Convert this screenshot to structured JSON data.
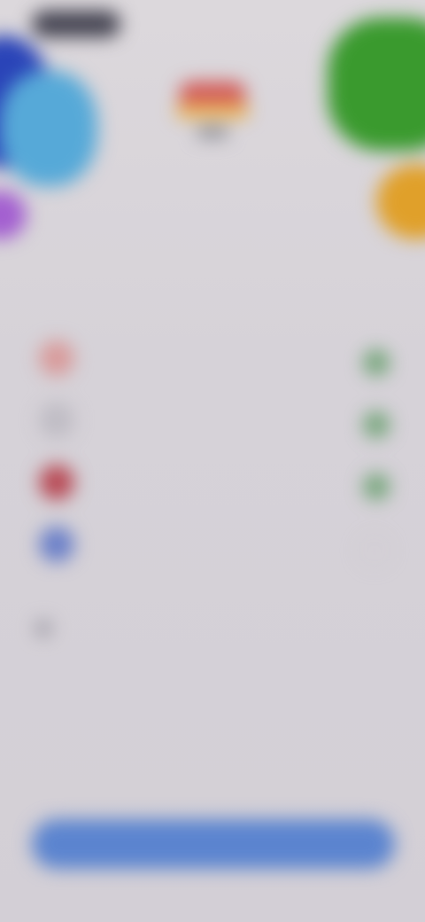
{
  "status_bar": {
    "time": ""
  },
  "header": {
    "title_main": "",
    "title_accent": "",
    "subtitle": ""
  },
  "section_caption": "",
  "permissions": [
    {
      "icon": "notification-icon",
      "title": "",
      "description": "",
      "granted": true,
      "color": "#d89a9a"
    },
    {
      "icon": "location-icon",
      "title": "",
      "description": "",
      "granted": true,
      "color": "#bfbcc4"
    },
    {
      "icon": "health-icon",
      "title": "",
      "description": "",
      "granted": true,
      "color": "#b84a55"
    },
    {
      "icon": "calendar-icon",
      "title": "",
      "description": "",
      "granted": false,
      "color": "#6a7fc8"
    }
  ],
  "footer_note": "",
  "continue_button": {
    "label": ""
  },
  "colors": {
    "accent_blue": "#5b84cf",
    "accent_red": "#c83a3a",
    "check_green": "#5b9a62",
    "background": "#d8d3d9"
  }
}
